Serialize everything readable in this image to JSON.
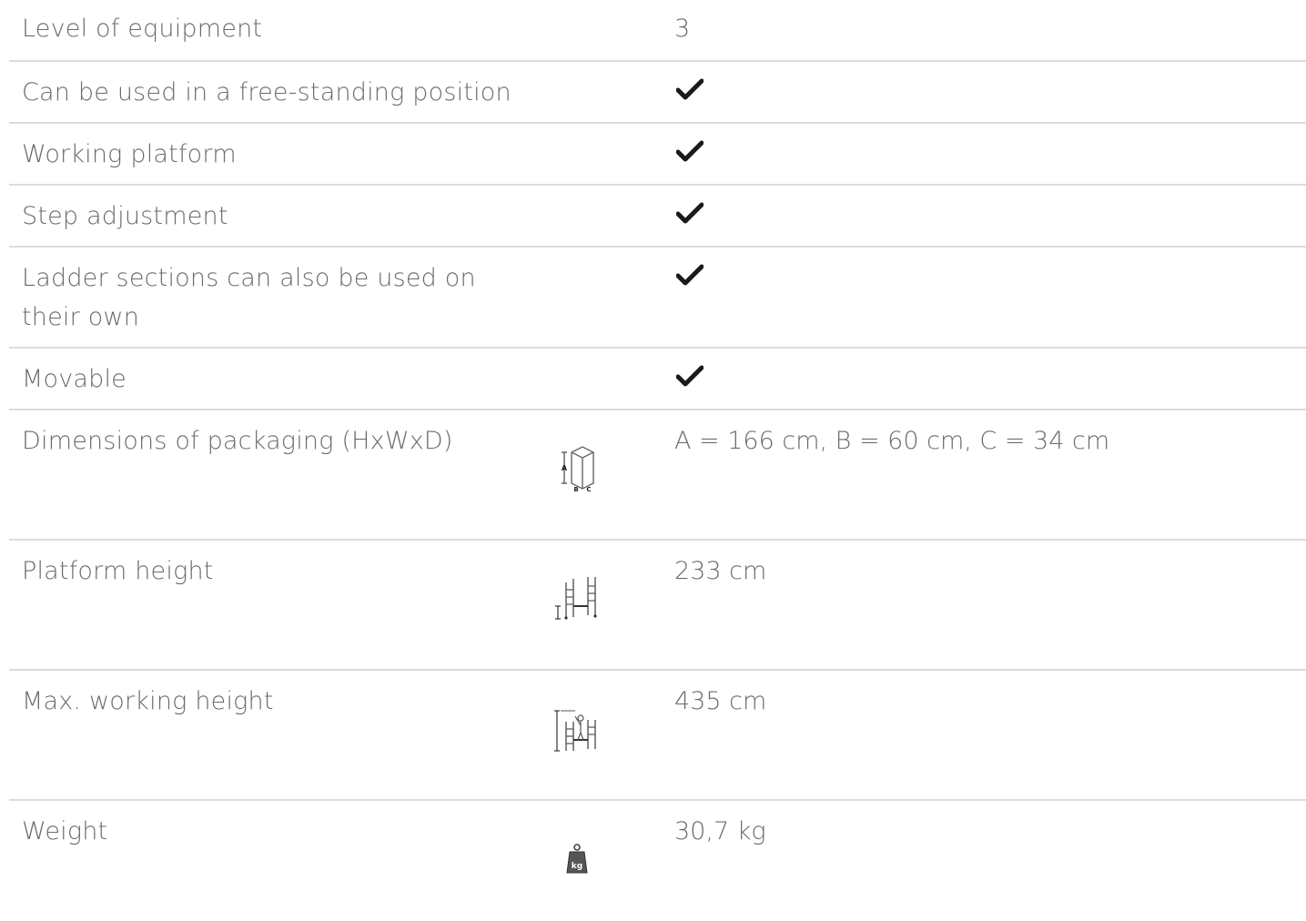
{
  "rows": [
    {
      "label": "Level of equipment",
      "value": "3"
    },
    {
      "label": "Can be used in a free-standing position",
      "value": "✔"
    },
    {
      "label": "Working platform",
      "value": "✔"
    },
    {
      "label": "Step adjustment",
      "value": "✔"
    },
    {
      "label": "Ladder sections can also be used on their own",
      "value": "✔"
    },
    {
      "label": "Movable",
      "value": "✔"
    },
    {
      "label": "Dimensions of packaging (HxWxD)",
      "value": "A = 166 cm, B = 60 cm, C = 34 cm",
      "icon": "package-dimensions-icon",
      "icon_letters": [
        "A",
        "B",
        "C"
      ]
    },
    {
      "label": "Platform height",
      "value": "233 cm",
      "icon": "platform-height-icon"
    },
    {
      "label": "Max. working height",
      "value": "435 cm",
      "icon": "working-height-icon"
    },
    {
      "label": "Weight",
      "value": "30,7 kg",
      "icon": "weight-icon",
      "icon_letters": [
        "kg"
      ]
    }
  ],
  "colors": {
    "text": "#6b6b6b",
    "divider": "#dcdcdc",
    "check": "#1a1a1a"
  }
}
